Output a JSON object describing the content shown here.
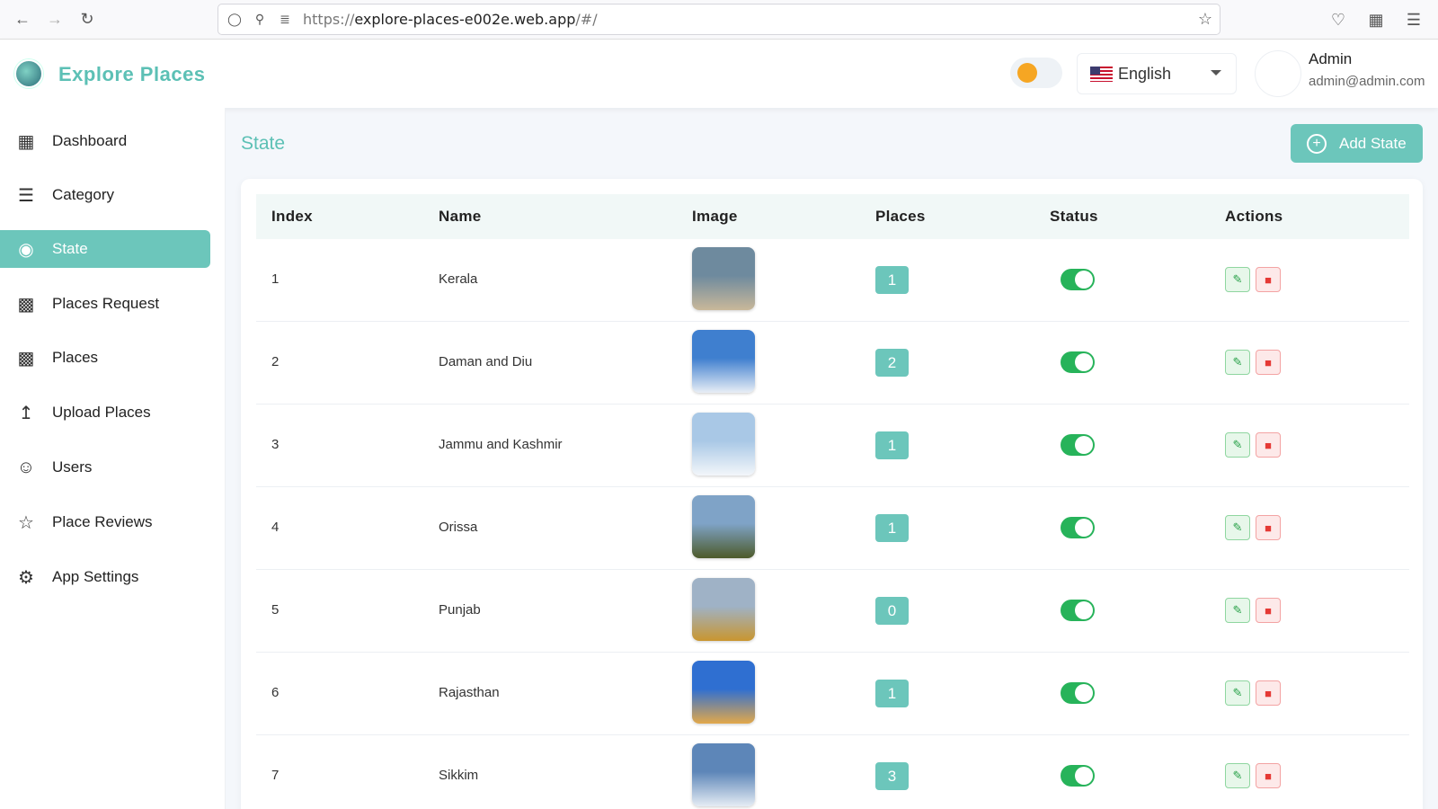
{
  "browser": {
    "url_scheme": "https://",
    "url_host": "explore-places-e002e.web.app",
    "url_path": "/#/"
  },
  "header": {
    "brand": "Explore Places",
    "language": "English",
    "user_name": "Admin",
    "user_email": "admin@admin.com"
  },
  "sidebar": {
    "items": [
      {
        "label": "Dashboard",
        "icon": "dashboard-icon"
      },
      {
        "label": "Category",
        "icon": "list-icon"
      },
      {
        "label": "State",
        "icon": "map-pin-icon",
        "active": true
      },
      {
        "label": "Places Request",
        "icon": "city-icon"
      },
      {
        "label": "Places",
        "icon": "city-icon"
      },
      {
        "label": "Upload Places",
        "icon": "upload-icon"
      },
      {
        "label": "Users",
        "icon": "users-icon"
      },
      {
        "label": "Place Reviews",
        "icon": "star-icon"
      },
      {
        "label": "App Settings",
        "icon": "gear-icon"
      }
    ]
  },
  "main": {
    "title": "State",
    "add_button": "Add State",
    "columns": [
      "Index",
      "Name",
      "Image",
      "Places",
      "Status",
      "Actions"
    ],
    "rows": [
      {
        "index": "1",
        "name": "Kerala",
        "places": "1",
        "status": true,
        "thumb": [
          "#6e8a9e",
          "#c9b89a"
        ]
      },
      {
        "index": "2",
        "name": "Daman and Diu",
        "places": "2",
        "status": true,
        "thumb": [
          "#3f7fcf",
          "#e8eef5"
        ]
      },
      {
        "index": "3",
        "name": "Jammu and Kashmir",
        "places": "1",
        "status": true,
        "thumb": [
          "#a9c8e6",
          "#f3f6fa"
        ]
      },
      {
        "index": "4",
        "name": "Orissa",
        "places": "1",
        "status": true,
        "thumb": [
          "#7fa3c7",
          "#4d5a2a"
        ]
      },
      {
        "index": "5",
        "name": "Punjab",
        "places": "0",
        "status": true,
        "thumb": [
          "#9fb2c6",
          "#c9962f"
        ]
      },
      {
        "index": "6",
        "name": "Rajasthan",
        "places": "1",
        "status": true,
        "thumb": [
          "#2f6fd1",
          "#e2a84a"
        ]
      },
      {
        "index": "7",
        "name": "Sikkim",
        "places": "3",
        "status": true,
        "thumb": [
          "#5d86b8",
          "#e5ecf4"
        ]
      }
    ]
  },
  "colors": {
    "accent": "#6cc6bb",
    "toggle_on": "#27b35a",
    "edit": "#2aa24a",
    "delete": "#e53935"
  }
}
